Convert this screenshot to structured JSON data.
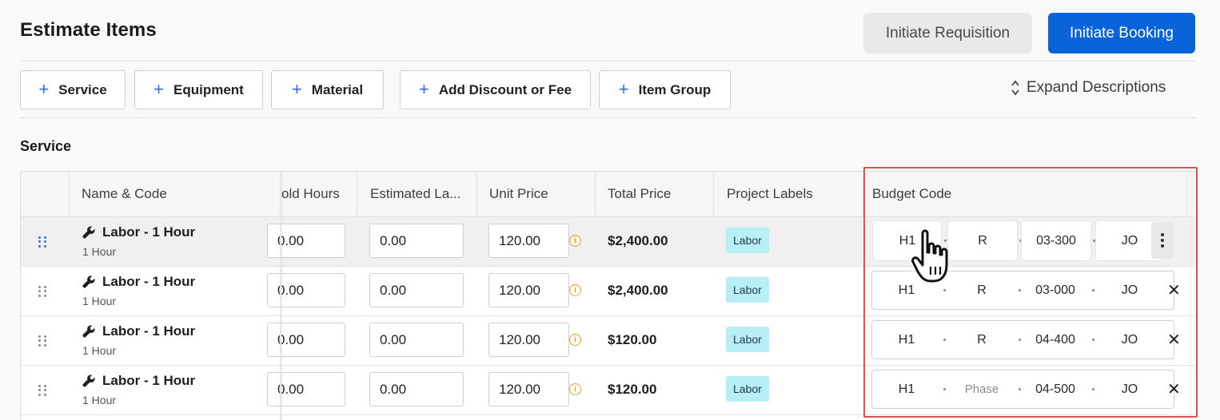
{
  "header": {
    "title": "Estimate Items",
    "requisition_label": "Initiate Requisition",
    "booking_label": "Initiate Booking"
  },
  "toolbar": {
    "add_buttons": [
      "Service",
      "Equipment",
      "Material",
      "Add Discount or Fee",
      "Item Group"
    ],
    "expand_label": "Expand Descriptions"
  },
  "section": {
    "title": "Service"
  },
  "table": {
    "columns": [
      "Name & Code",
      "old Hours",
      "Estimated La...",
      "Unit Price",
      "Total Price",
      "Project Labels",
      "Budget Code"
    ],
    "rows": [
      {
        "name": "Labor - 1 Hour",
        "sub": "1 Hour",
        "hours": "0.00",
        "est_labor": "0.00",
        "unit_price": "120.00",
        "total": "$2,400.00",
        "label": "Labor",
        "budget": [
          "H1",
          "R",
          "03-300",
          "JO"
        ]
      },
      {
        "name": "Labor - 1 Hour",
        "sub": "1 Hour",
        "hours": "0.00",
        "est_labor": "0.00",
        "unit_price": "120.00",
        "total": "$2,400.00",
        "label": "Labor",
        "budget": [
          "H1",
          "R",
          "03-000",
          "JO"
        ]
      },
      {
        "name": "Labor - 1 Hour",
        "sub": "1 Hour",
        "hours": "0.00",
        "est_labor": "0.00",
        "unit_price": "120.00",
        "total": "$120.00",
        "label": "Labor",
        "budget": [
          "H1",
          "R",
          "04-400",
          "JO"
        ]
      },
      {
        "name": "Labor - 1 Hour",
        "sub": "1 Hour",
        "hours": "0.00",
        "est_labor": "0.00",
        "unit_price": "120.00",
        "total": "$120.00",
        "label": "Labor",
        "budget": [
          "H1",
          "Phase",
          "04-500",
          "JO"
        ]
      }
    ]
  },
  "icons": {
    "plus": "+",
    "close": "✕",
    "info": "i"
  },
  "colors": {
    "primary": "#0a63d8",
    "badge": "#b8eef6",
    "highlight": "#d9534f",
    "info": "#e3a41a"
  }
}
